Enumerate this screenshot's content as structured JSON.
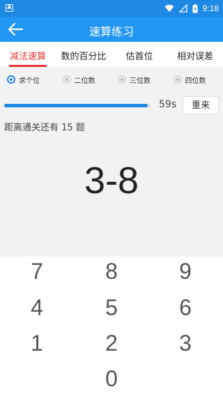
{
  "status": {
    "time": "9:18",
    "notification_letter": "A"
  },
  "toolbar": {
    "title": "速算练习"
  },
  "tabs": [
    {
      "label": "减法速算",
      "active": true
    },
    {
      "label": "数的百分比",
      "active": false
    },
    {
      "label": "估首位",
      "active": false
    },
    {
      "label": "相对误差",
      "active": false
    }
  ],
  "options": [
    {
      "label": "求个位",
      "checked": true
    },
    {
      "label": "二位数",
      "checked": false
    },
    {
      "label": "三位数",
      "checked": false
    },
    {
      "label": "四位数",
      "checked": false
    }
  ],
  "progress": {
    "fraction": 0.98,
    "time_label": "59s"
  },
  "reset_label": "重来",
  "remaining_text": "距离通关还有 15 题",
  "question": "3-8",
  "keypad": {
    "keys": [
      "7",
      "8",
      "9",
      "4",
      "5",
      "6",
      "1",
      "2",
      "3",
      "0"
    ]
  },
  "colors": {
    "primary": "#2196f3",
    "status_bar": "#1e88e5",
    "accent": "#e53935"
  }
}
